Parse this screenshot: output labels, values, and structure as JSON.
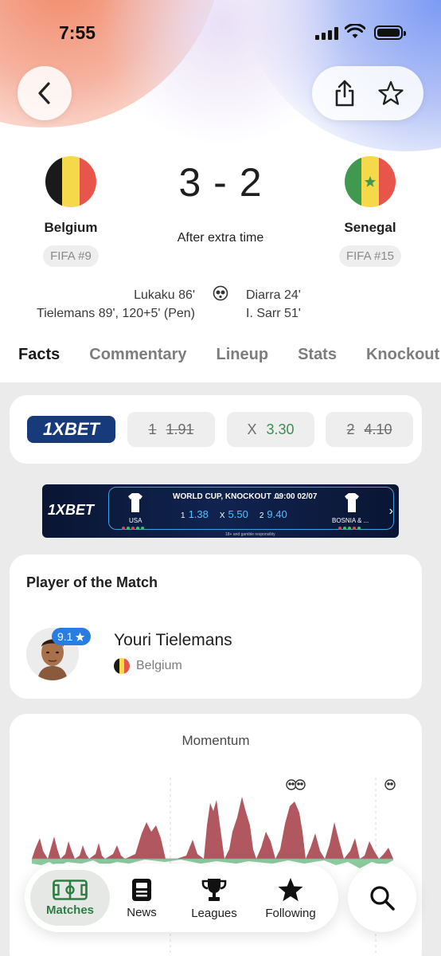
{
  "status_bar": {
    "time": "7:55"
  },
  "match": {
    "home": {
      "name": "Belgium",
      "rank": "FIFA #9",
      "flag_colors": [
        "#1a1a1a",
        "#f5d94a",
        "#e8554a"
      ]
    },
    "away": {
      "name": "Senegal",
      "rank": "FIFA #15",
      "flag_colors": [
        "#3f9a4f",
        "#f5d94a",
        "#e8554a"
      ]
    },
    "score": "3 - 2",
    "status": "After extra time",
    "home_scorers": [
      "Lukaku 86'",
      "Tielemans 89', 120+5' (Pen)"
    ],
    "away_scorers": [
      "Diarra 24'",
      "I.  Sarr 51'"
    ]
  },
  "tabs": [
    "Facts",
    "Commentary",
    "Lineup",
    "Stats",
    "Knockout"
  ],
  "odds": {
    "brand": "1XBET",
    "home_label": "1",
    "home_value": "1.91",
    "draw_label": "X",
    "draw_value": "3.30",
    "away_label": "2",
    "away_value": "4.10"
  },
  "ad_banner": {
    "brand": "1XBET",
    "title": "WORLD CUP, KNOCKOUT ...",
    "time": "09:00 02/07",
    "team1": "USA",
    "team2": "BOSNIA & ...",
    "o1_label": "1",
    "o1": "1.38",
    "ox_label": "X",
    "ox": "5.50",
    "o2_label": "2",
    "o2": "9.40",
    "note": "18+ and gamble responsibly"
  },
  "player_of_match": {
    "title": "Player of the Match",
    "rating": "9.1",
    "name": "Youri Tielemans",
    "team": "Belgium"
  },
  "momentum": {
    "title": "Momentum",
    "home_color": "#a8454f",
    "away_color": "#6fbf86"
  },
  "bottom_nav": {
    "matches": "Matches",
    "news": "News",
    "leagues": "Leagues",
    "following": "Following"
  },
  "colors": {
    "accent_green": "#2e7d44",
    "rating_blue": "#2a7de0",
    "odds_green": "#3a8f4f"
  }
}
